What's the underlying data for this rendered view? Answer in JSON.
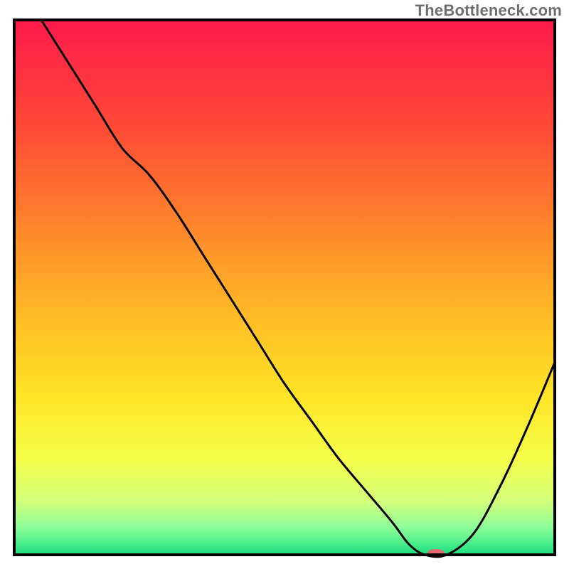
{
  "watermark": "TheBottleneck.com",
  "chart_data": {
    "type": "line",
    "title": "",
    "xlabel": "",
    "ylabel": "",
    "xlim": [
      0,
      100
    ],
    "ylim": [
      0,
      100
    ],
    "x": [
      5,
      10,
      15,
      20,
      25,
      30,
      35,
      40,
      45,
      50,
      55,
      60,
      65,
      70,
      73,
      76,
      80,
      85,
      90,
      95,
      100
    ],
    "values": [
      100,
      92,
      84,
      76,
      71,
      64,
      56,
      48,
      40,
      32,
      25,
      18,
      12,
      6,
      2,
      0,
      0,
      4,
      13,
      24,
      36
    ],
    "optimum_x": 78,
    "axes_visible": false,
    "grid": false,
    "gradient_stops": [
      {
        "offset": 0.0,
        "color": "#ff1a4b"
      },
      {
        "offset": 0.2,
        "color": "#ff4a36"
      },
      {
        "offset": 0.4,
        "color": "#ff8a2a"
      },
      {
        "offset": 0.55,
        "color": "#ffba26"
      },
      {
        "offset": 0.7,
        "color": "#ffe326"
      },
      {
        "offset": 0.82,
        "color": "#f6ff4a"
      },
      {
        "offset": 0.9,
        "color": "#d3ff7a"
      },
      {
        "offset": 0.95,
        "color": "#8bff9a"
      },
      {
        "offset": 1.0,
        "color": "#1adf7e"
      }
    ],
    "marker": {
      "color": "#e26a6a",
      "rx": 12,
      "ry": 5
    },
    "frame_color": "#000000"
  }
}
